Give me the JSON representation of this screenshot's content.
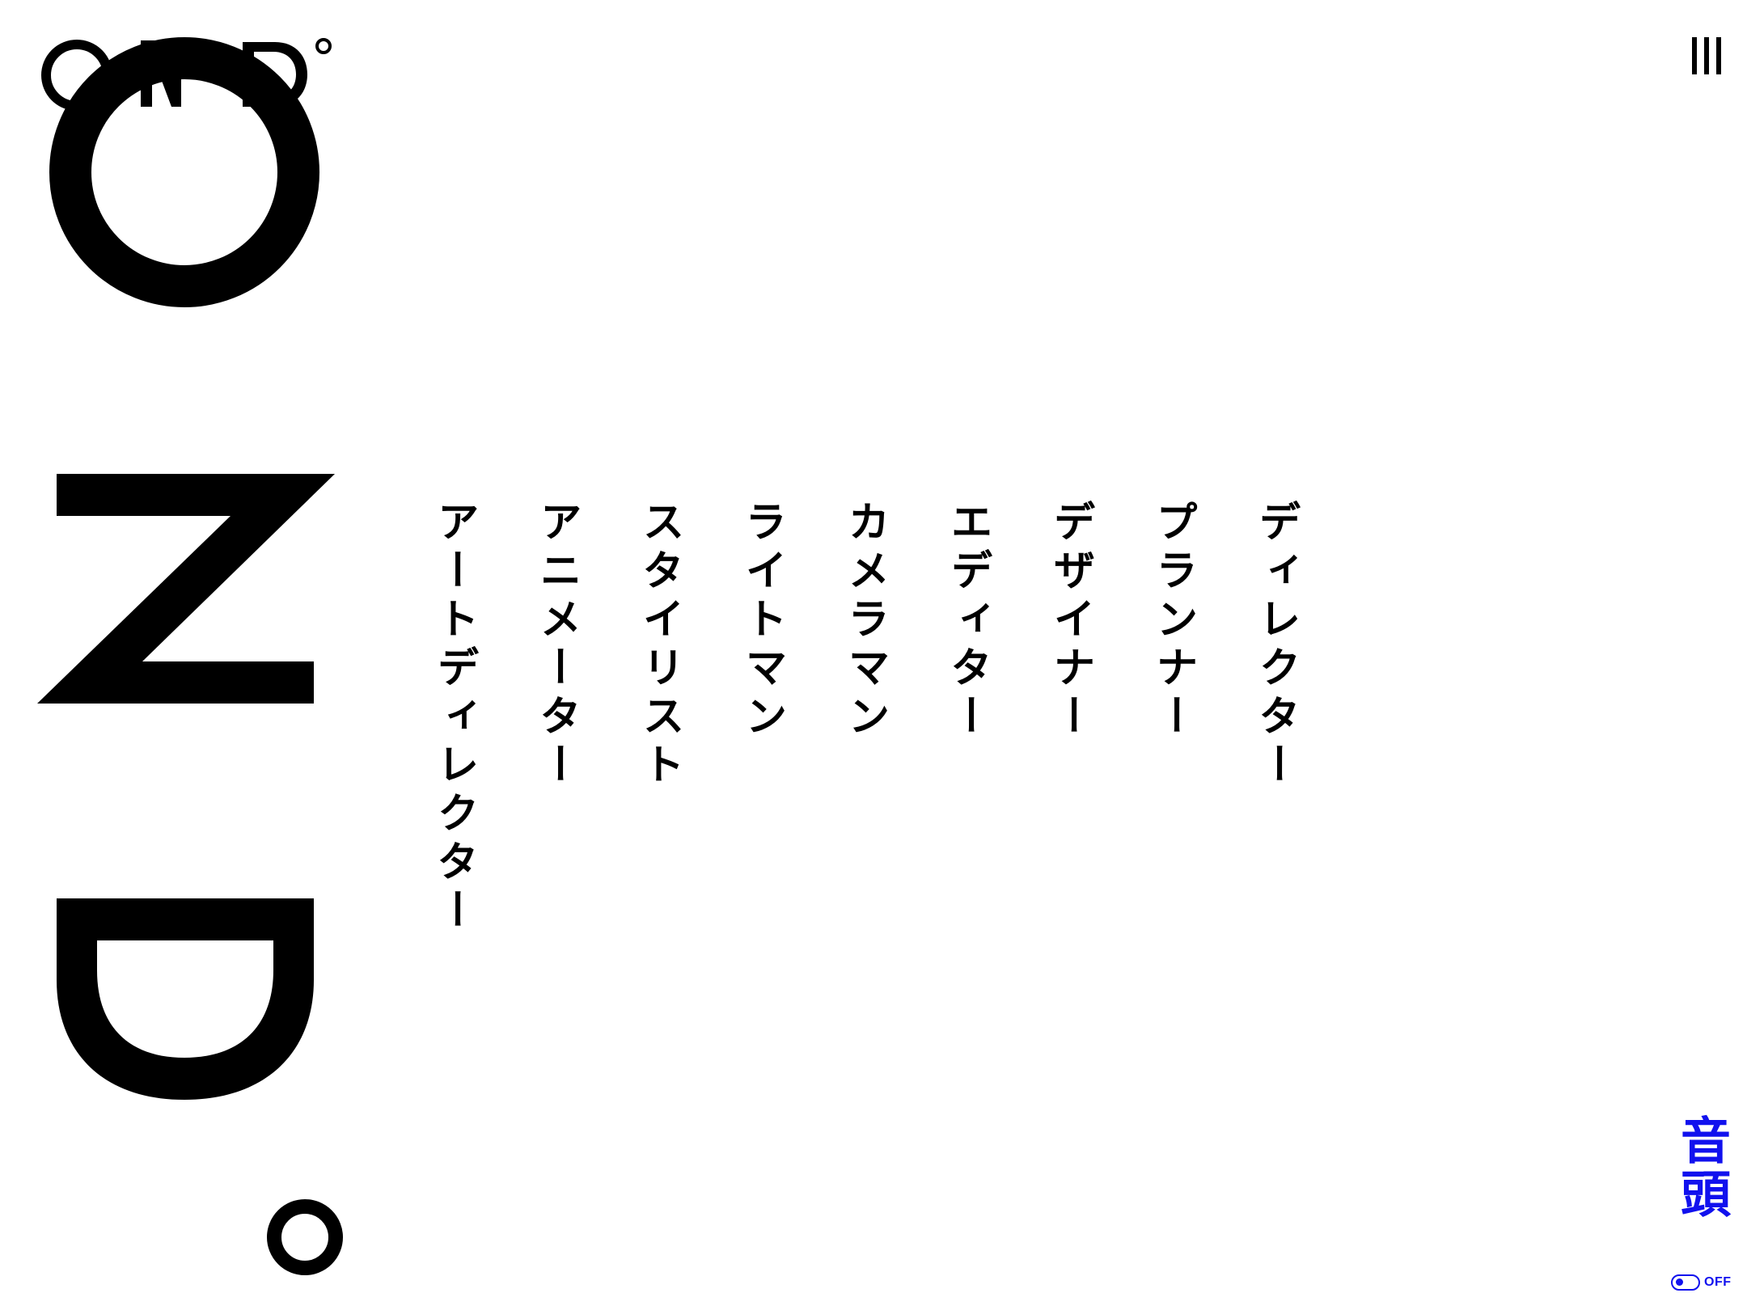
{
  "header": {
    "logo_small_alt": "ON D°",
    "menu_icon": "hamburger-vertical-icon"
  },
  "logo_large": {
    "letters": [
      "O",
      "N",
      "D",
      "°"
    ]
  },
  "roles": [
    "ディレクター",
    "プランナー",
    "デザイナー",
    "エディター",
    "カメラマン",
    "ライトマン",
    "スタイリスト",
    "アニメーター",
    "アートディレクター"
  ],
  "sound": {
    "label": "音頭",
    "toggle_state": "OFF"
  },
  "colors": {
    "background": "#ffffff",
    "text": "#000000",
    "accent": "#1111ee"
  }
}
